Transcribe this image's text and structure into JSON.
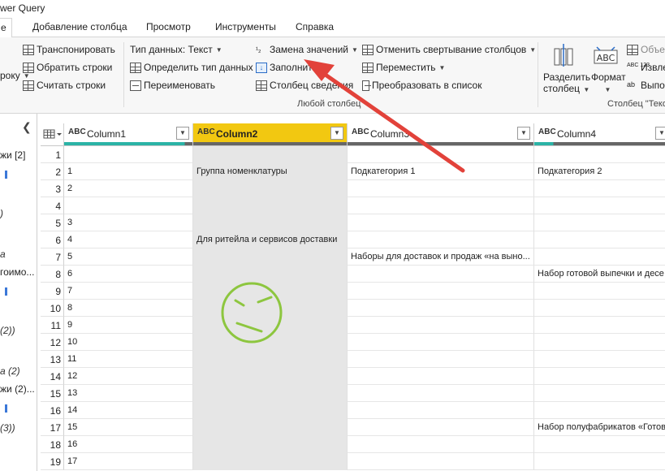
{
  "window": {
    "title": "wer Query"
  },
  "tabs": [
    {
      "label": "е",
      "active": true
    },
    {
      "label": "Добавление столбца"
    },
    {
      "label": "Просмотр"
    },
    {
      "label": "Инструменты"
    },
    {
      "label": "Справка"
    }
  ],
  "ribbon": {
    "table_group": {
      "transpose": "Транспонировать",
      "reverse_rows": "Обратить строки",
      "count_rows": "Считать строки",
      "cut_label": "року"
    },
    "any_column": {
      "data_type": "Тип данных: Текст",
      "detect_type": "Определить тип данных",
      "rename": "Переименовать",
      "replace_values": "Замена значений",
      "fill": "Заполнить",
      "pivot_column": "Столбец сведения",
      "unpivot": "Отменить свертывание столбцов",
      "move": "Переместить",
      "to_list": "Преобразовать в список",
      "group_label": "Любой столбец"
    },
    "text_column": {
      "split_line1": "Разделить",
      "split_line2": "столбец",
      "format": "Формат",
      "merge": "Объе",
      "extract": "Извле",
      "parse": "Выпо",
      "abc_badge": "ABC",
      "group_label": "Столбец \"Теко"
    }
  },
  "left_panel": {
    "items": [
      {
        "text": "жи [2]",
        "italic": false
      },
      {
        "text": ")",
        "italic": true
      },
      {
        "text": "а",
        "italic": true
      },
      {
        "text": "гоимо...",
        "italic": false
      },
      {
        "text": "(2))",
        "italic": true
      },
      {
        "text": "а (2)",
        "italic": true
      },
      {
        "text": "жи (2)...",
        "italic": false
      },
      {
        "text": "(3))",
        "italic": true
      }
    ]
  },
  "grid": {
    "type_badge": "ABC",
    "columns": [
      {
        "name": "Column1",
        "selected": false
      },
      {
        "name": "Column2",
        "selected": true
      },
      {
        "name": "Column3",
        "selected": false
      },
      {
        "name": "Column4",
        "selected": false
      }
    ],
    "rows": [
      {
        "n": "1",
        "c": [
          "",
          "",
          "",
          ""
        ]
      },
      {
        "n": "2",
        "c": [
          "1",
          "Группа номенклатуры",
          "Подкатегория 1",
          "Подкатегория 2"
        ]
      },
      {
        "n": "3",
        "c": [
          "2",
          "",
          "",
          ""
        ]
      },
      {
        "n": "4",
        "c": [
          "",
          "",
          "",
          ""
        ]
      },
      {
        "n": "5",
        "c": [
          "3",
          "",
          "",
          ""
        ]
      },
      {
        "n": "6",
        "c": [
          "4",
          "Для ритейла и сервисов доставки",
          "",
          ""
        ]
      },
      {
        "n": "7",
        "c": [
          "5",
          "",
          "Наборы для доставок и продаж «на выно...",
          ""
        ]
      },
      {
        "n": "8",
        "c": [
          "6",
          "",
          "",
          "Набор готовой выпечки и десе"
        ]
      },
      {
        "n": "9",
        "c": [
          "7",
          "",
          "",
          ""
        ]
      },
      {
        "n": "10",
        "c": [
          "8",
          "",
          "",
          ""
        ]
      },
      {
        "n": "11",
        "c": [
          "9",
          "",
          "",
          ""
        ]
      },
      {
        "n": "12",
        "c": [
          "10",
          "",
          "",
          ""
        ]
      },
      {
        "n": "13",
        "c": [
          "11",
          "",
          "",
          ""
        ]
      },
      {
        "n": "14",
        "c": [
          "12",
          "",
          "",
          ""
        ]
      },
      {
        "n": "15",
        "c": [
          "13",
          "",
          "",
          ""
        ]
      },
      {
        "n": "16",
        "c": [
          "14",
          "",
          "",
          ""
        ]
      },
      {
        "n": "17",
        "c": [
          "15",
          "",
          "",
          "Набор полуфабрикатов «Готов"
        ]
      },
      {
        "n": "18",
        "c": [
          "16",
          "",
          "",
          ""
        ]
      },
      {
        "n": "19",
        "c": [
          "17",
          "",
          "",
          ""
        ]
      }
    ]
  },
  "colors": {
    "selected_header": "#f2c811",
    "quality_bar": "#2bb3a6",
    "arrow": "#e2423a",
    "annotation_face": "#8dc63f",
    "selected_column_bg": "#e6e6e6"
  }
}
